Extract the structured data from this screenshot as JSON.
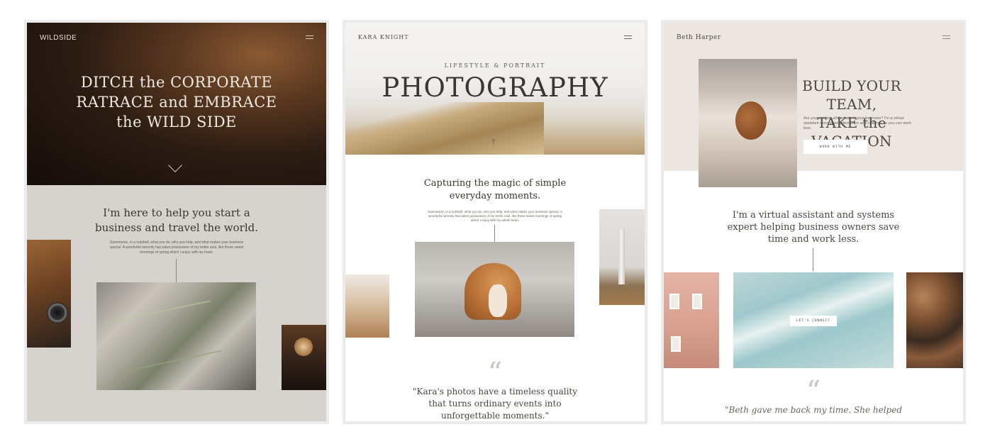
{
  "card1": {
    "brand": "WILDSIDE",
    "hero_title_line1": "DITCH the CORPORATE",
    "hero_title_line2": "RATRACE and EMBRACE",
    "hero_title_line3": "the WILD SIDE",
    "headline_line1": "I'm here to help you start a",
    "headline_line2": "business and travel the world.",
    "body": "Summarize, in a nutshell, what you do, who you help, and what makes your business special. A wonderful serenity has taken possession of my entire soul, like these sweet mornings of spring which I enjoy with my heart."
  },
  "card2": {
    "brand": "KARA KNIGHT",
    "subtitle": "LIFESTYLE & PORTRAIT",
    "title": "PHOTOGRAPHY",
    "logo": "ᛉ",
    "headline_line1": "Capturing the magic of simple",
    "headline_line2": "everyday moments.",
    "body": "Summarize, in a nutshell, what you do, who you help, and what makes your business special. A wonderful serenity has taken possession of my entire soul, like these sweet mornings of spring which I enjoy with my whole heart.",
    "quote_mark": "“",
    "quote_line1": "\"Kara's photos have a timeless quality",
    "quote_line2": "that turns ordinary events into",
    "quote_line3": "unforgettable moments.\""
  },
  "card3": {
    "brand": "Beth Harper",
    "hero_title_line1": "BUILD YOUR TEAM,",
    "hero_title_line2": "TAKE the VACATION",
    "body": "Are you wearing all the hats in your business? I'm a virtual assistant serving web designers and coaches so you can work less.",
    "cta_label": "WORK WITH ME",
    "headline_line1": "I'm a virtual assistant and systems",
    "headline_line2": "expert helping business owners save",
    "headline_line3": "time and work less.",
    "connect_label": "LET'S CONNECT",
    "quote_mark": "“",
    "quote_line1": "\"Beth gave me back my time. She helped"
  }
}
